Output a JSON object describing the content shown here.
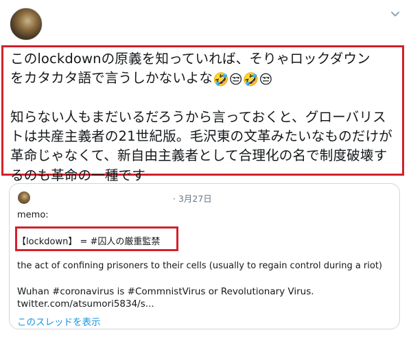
{
  "tweet": {
    "line1": "このlockdownの原義を知っていれば、そりゃロックダウン",
    "line2_text": "をカタカタ語で言うしかないよな",
    "emojis": [
      "🤣",
      "😒",
      "🤣",
      "😒"
    ],
    "paragraph2": "知らない人もまだいるだろうから言っておくと、グローバリストは共産主義者の21世紀版。毛沢東の文革みたいなものだけが革命じゃなくて、新自由主義者として合理化の名で制度破壊するのも革命の一種です"
  },
  "quote": {
    "date": "· 3月27日",
    "memo": "memo:",
    "lockdown_line": "【lockdown】 = #囚人の厳重監禁",
    "definition": "the act of confining prisoners to their cells (usually to regain control during a riot)",
    "wuhan_line": "Wuhan #coronavirus is #CommnistVirus or Revolutionary Virus.",
    "link": "twitter.com/atsumori5834/s...",
    "show_thread": "このスレッドを表示"
  },
  "icons": {
    "menu": "chevron-down-icon",
    "avatar": "user-avatar",
    "quote_avatar": "quoted-user-avatar"
  },
  "colors": {
    "highlight_border": "#d2202a",
    "link": "#1b95e0",
    "muted": "#657786",
    "card_border": "#ccd6dd"
  }
}
